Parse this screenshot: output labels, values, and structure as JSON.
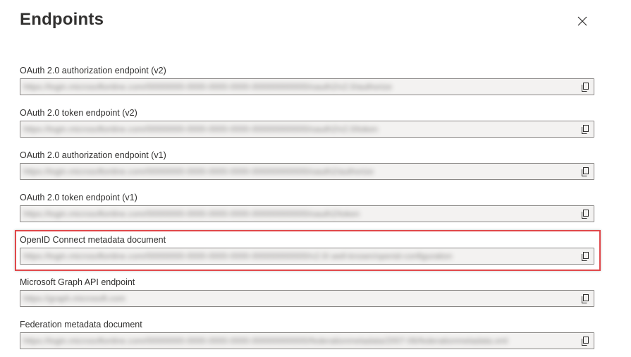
{
  "dialog": {
    "title": "Endpoints"
  },
  "icons": {
    "close": "close-icon",
    "copy": "copy-icon"
  },
  "endpoints": [
    {
      "label": "OAuth 2.0 authorization endpoint (v2)",
      "value": "https://login.microsoftonline.com/00000000-0000-0000-0000-000000000000/oauth2/v2.0/authorize"
    },
    {
      "label": "OAuth 2.0 token endpoint (v2)",
      "value": "https://login.microsoftonline.com/00000000-0000-0000-0000-000000000000/oauth2/v2.0/token"
    },
    {
      "label": "OAuth 2.0 authorization endpoint (v1)",
      "value": "https://login.microsoftonline.com/00000000-0000-0000-0000-000000000000/oauth2/authorize"
    },
    {
      "label": "OAuth 2.0 token endpoint (v1)",
      "value": "https://login.microsoftonline.com/00000000-0000-0000-0000-000000000000/oauth2/token"
    },
    {
      "label": "OpenID Connect metadata document",
      "value": "https://login.microsoftonline.com/00000000-0000-0000-0000-000000000000/v2.0/.well-known/openid-configuration"
    },
    {
      "label": "Microsoft Graph API endpoint",
      "value": "https://graph.microsoft.com"
    },
    {
      "label": "Federation metadata document",
      "value": "https://login.microsoftonline.com/00000000-0000-0000-0000-000000000000/federationmetadata/2007-06/federationmetadata.xml"
    }
  ],
  "colors": {
    "highlight": "#e0474a",
    "field_background": "#f3f2f1",
    "field_border": "#8a8886"
  }
}
